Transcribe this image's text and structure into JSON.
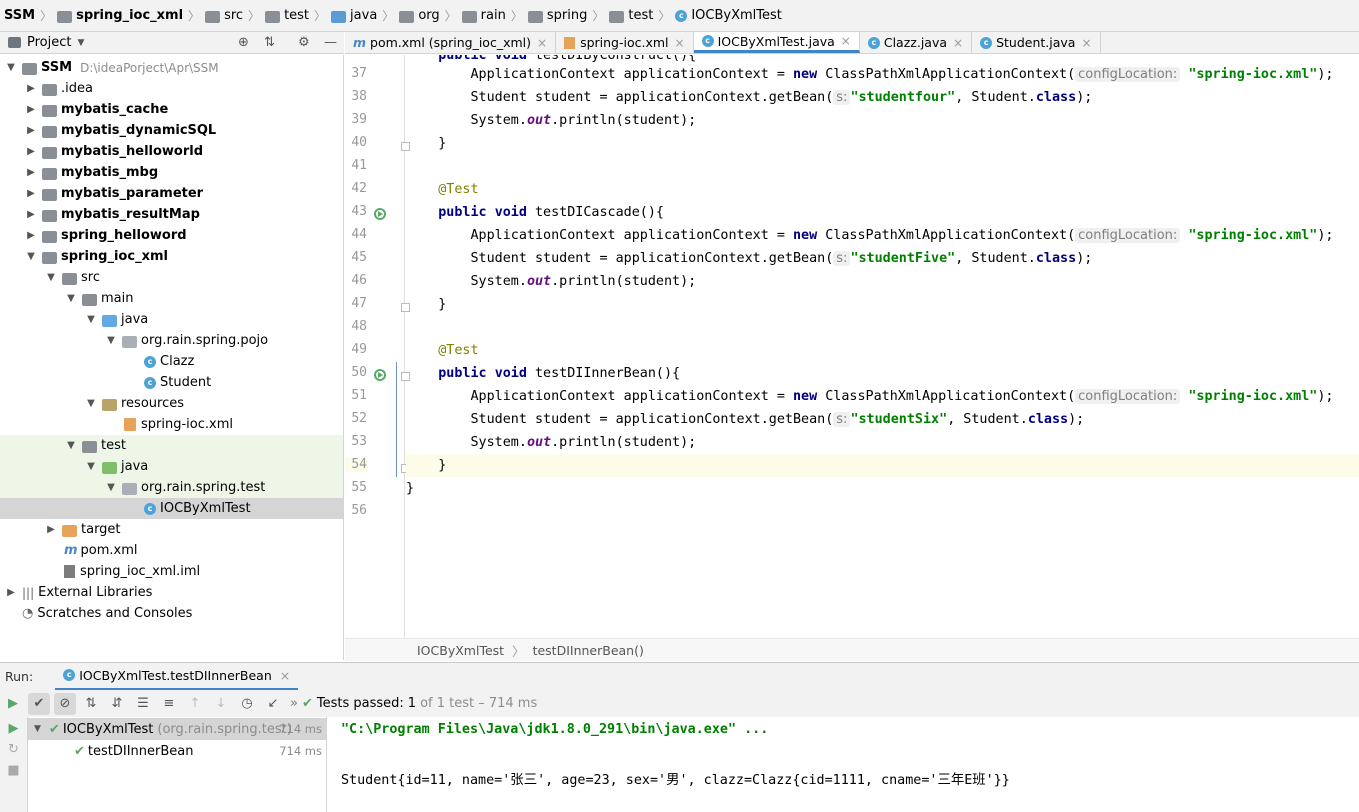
{
  "breadcrumb": {
    "items": [
      "SSM",
      "spring_ioc_xml",
      "src",
      "test",
      "java",
      "org",
      "rain",
      "spring",
      "test",
      "IOCByXmlTest"
    ]
  },
  "project_panel": {
    "title": "Project",
    "tree": [
      {
        "label": "SSM",
        "extra": "D:\\ideaPorject\\Apr\\SSM",
        "bold": true
      },
      {
        "label": ".idea"
      },
      {
        "label": "mybatis_cache",
        "bold": true
      },
      {
        "label": "mybatis_dynamicSQL",
        "bold": true
      },
      {
        "label": "mybatis_helloworld",
        "bold": true
      },
      {
        "label": "mybatis_mbg",
        "bold": true
      },
      {
        "label": "mybatis_parameter",
        "bold": true
      },
      {
        "label": "mybatis_resultMap",
        "bold": true
      },
      {
        "label": "spring_helloword",
        "bold": true
      },
      {
        "label": "spring_ioc_xml",
        "bold": true
      },
      {
        "label": "src"
      },
      {
        "label": "main"
      },
      {
        "label": "java"
      },
      {
        "label": "org.rain.spring.pojo"
      },
      {
        "label": "Clazz"
      },
      {
        "label": "Student"
      },
      {
        "label": "resources"
      },
      {
        "label": "spring-ioc.xml"
      },
      {
        "label": "test"
      },
      {
        "label": "java"
      },
      {
        "label": "org.rain.spring.test"
      },
      {
        "label": "IOCByXmlTest"
      },
      {
        "label": "target"
      },
      {
        "label": "pom.xml"
      },
      {
        "label": "spring_ioc_xml.iml"
      },
      {
        "label": "External Libraries"
      },
      {
        "label": "Scratches and Consoles"
      }
    ]
  },
  "editor": {
    "tabs": [
      {
        "label": "pom.xml (spring_ioc_xml)",
        "icon": "maven-icon"
      },
      {
        "label": "spring-ioc.xml",
        "icon": "xml-icon"
      },
      {
        "label": "IOCByXmlTest.java",
        "icon": "class-icon",
        "active": true
      },
      {
        "label": "Clazz.java",
        "icon": "class-icon"
      },
      {
        "label": "Student.java",
        "icon": "class-icon"
      }
    ],
    "line_numbers": [
      "37",
      "38",
      "39",
      "40",
      "41",
      "42",
      "43",
      "44",
      "45",
      "46",
      "47",
      "48",
      "49",
      "50",
      "51",
      "52",
      "53",
      "54",
      "55",
      "56"
    ],
    "code": {
      "l37a": "        ApplicationContext applicationContext = ",
      "kw_new": "new",
      "l37b": " ClassPathXmlApplicationContext(",
      "hint_config": "configLocation:",
      "str_spring_ioc": "\"spring-ioc.xml\"",
      "close_semi": ");",
      "l38a": "        Student student = applicationContext.getBean(",
      "hint_s": "s:",
      "str_four": "\"studentfour\"",
      "l38b": ", Student.",
      "kw_class": "class",
      "l39a": "        System.",
      "out": "out",
      "l39b": ".println(student);",
      "brace_close_indent": "    }",
      "ann_test": "    @Test",
      "kw_public": "public",
      "kw_void": "void",
      "l43": " testDICascade(){",
      "str_five": "\"studentFive\"",
      "l50": " testDIInnerBean(){",
      "str_six": "\"studentSix\"",
      "brace_close": "}",
      "indent4": "    ",
      "sp": " "
    },
    "breadcrumb": [
      "IOCByXmlTest",
      "testDIInnerBean()"
    ]
  },
  "run": {
    "label": "Run:",
    "config": "IOCByXmlTest.testDIInnerBean",
    "status_prefix": "Tests passed:",
    "status_count": "1",
    "status_suffix": "of 1 test – 714 ms",
    "tree": [
      {
        "name": "IOCByXmlTest",
        "pkg": "(org.rain.spring.test)",
        "time": "714 ms"
      },
      {
        "name": "testDIInnerBean",
        "time": "714 ms"
      }
    ],
    "console": [
      "\"C:\\Program Files\\Java\\jdk1.8.0_291\\bin\\java.exe\" ...",
      "Student{id=11, name='张三', age=23, sex='男', clazz=Clazz{cid=1111, cname='三年E班'}}"
    ]
  },
  "colors": {
    "accent": "#4083c9",
    "pass_green": "#59a869",
    "keyword": "#000080",
    "string": "#008000"
  }
}
